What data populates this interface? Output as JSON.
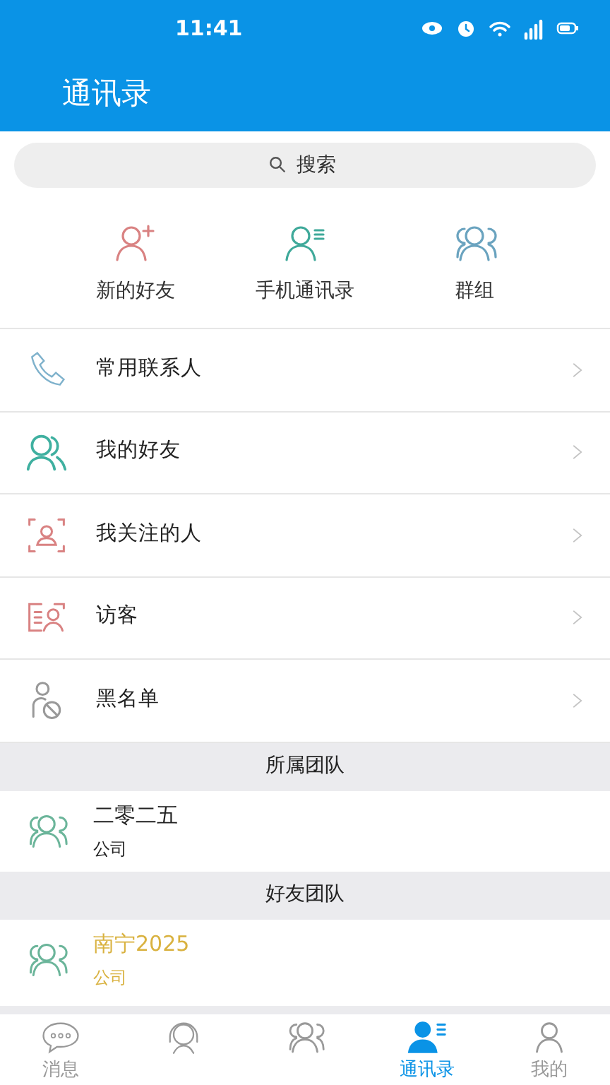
{
  "status_bar": {
    "time": "11:41"
  },
  "header": {
    "title": "通讯录"
  },
  "search": {
    "placeholder": "搜索"
  },
  "shortcuts": [
    {
      "kind": "add-person",
      "label": "新的好友"
    },
    {
      "kind": "person-list",
      "label": "手机通讯录"
    },
    {
      "kind": "group",
      "label": "群组"
    }
  ],
  "menu": [
    {
      "kind": "phone",
      "label": "常用联系人"
    },
    {
      "kind": "friends",
      "label": "我的好友"
    },
    {
      "kind": "focus",
      "label": "我关注的人"
    },
    {
      "kind": "card",
      "label": "访客"
    },
    {
      "kind": "block",
      "label": "黑名单"
    }
  ],
  "team_sections": [
    {
      "title": "所属团队",
      "teams": [
        {
          "name": "二零二五",
          "type": "公司",
          "color": "#222222"
        }
      ]
    },
    {
      "title": "好友团队",
      "teams": [
        {
          "name": "南宁2025",
          "type": "公司",
          "color": "#d9b240"
        }
      ]
    }
  ],
  "tab_bar": [
    {
      "kind": "chat",
      "label": "消息",
      "selected": false
    },
    {
      "kind": "service",
      "selected": false
    },
    {
      "kind": "group",
      "selected": false
    },
    {
      "kind": "contacts",
      "label": "通讯录",
      "selected": true
    },
    {
      "kind": "me",
      "label": "我的",
      "selected": false
    }
  ]
}
